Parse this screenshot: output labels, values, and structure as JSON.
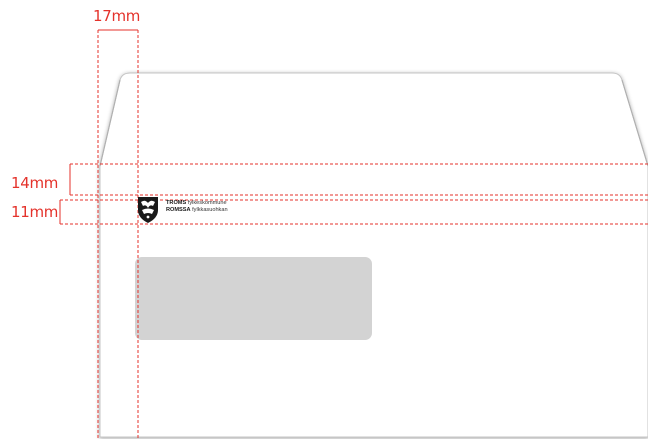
{
  "measurements": {
    "left_margin": "17mm",
    "top_to_logo": "14mm",
    "logo_height": "11mm"
  },
  "logo": {
    "line1_bold": "TROMS",
    "line1_light": "fylkeskommune",
    "line2_bold": "ROMSSA",
    "line2_light": "fylkkasuohkan"
  },
  "colors": {
    "guide_line": "#e4322b",
    "window": "#d3d3d3",
    "envelope_fill": "#ffffff",
    "envelope_stroke": "#bdbdbd"
  },
  "icons": {
    "coat_of_arms": "shield-icon"
  }
}
